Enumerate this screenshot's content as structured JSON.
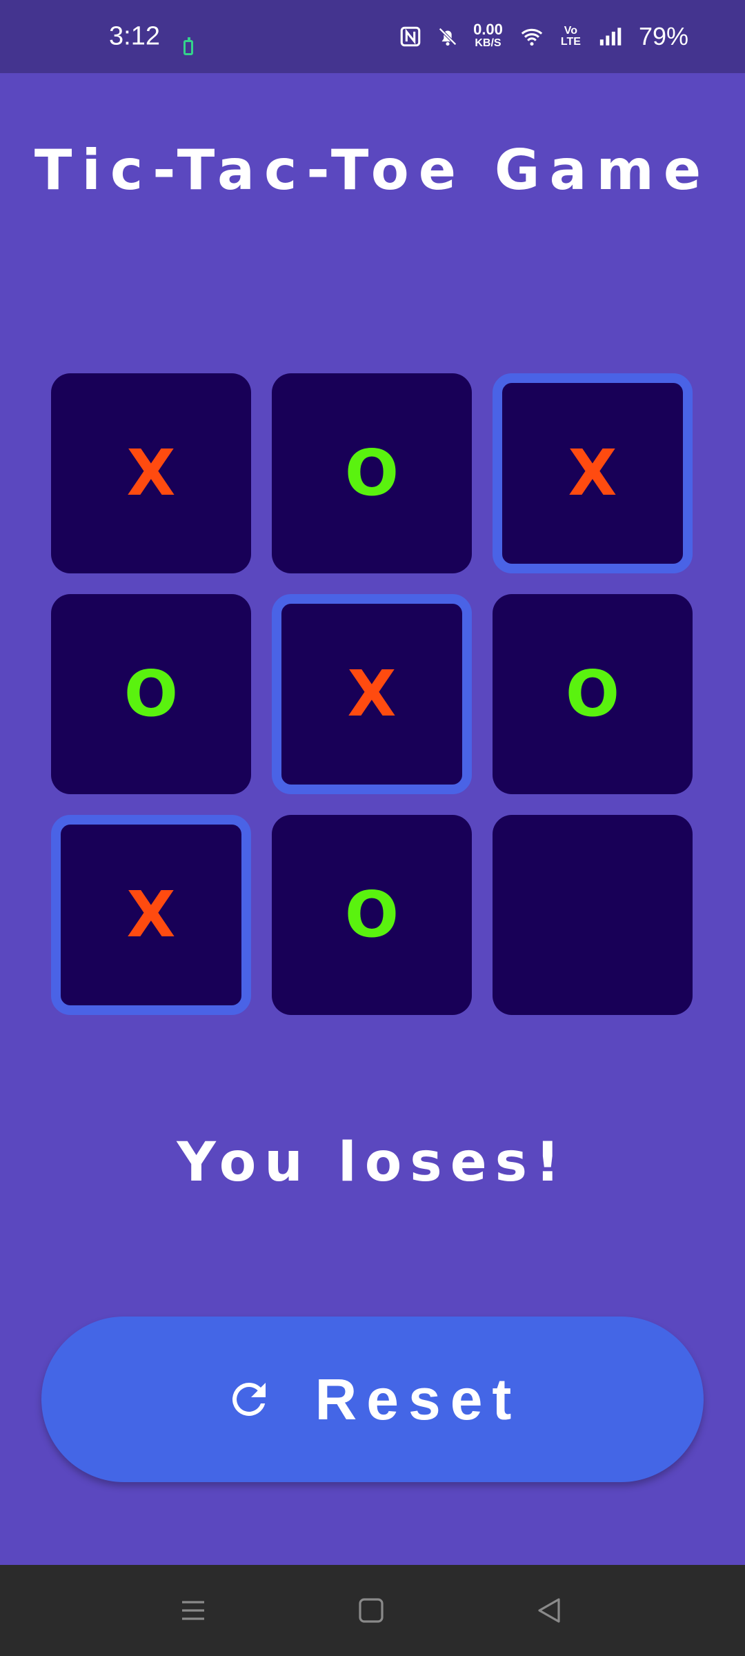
{
  "status_bar": {
    "time": "3:12",
    "network_speed_value": "0.00",
    "network_speed_unit": "KB/S",
    "volte_top": "Vo",
    "volte_bottom": "LTE",
    "battery_percent": "79%"
  },
  "title": "Tic-Tac-Toe Game",
  "board": {
    "cells": [
      "X",
      "O",
      "X",
      "O",
      "X",
      "O",
      "X",
      "O",
      ""
    ],
    "winning_cells": [
      2,
      4,
      6
    ],
    "colors": {
      "x": "#ff4b10",
      "o": "#5af20f",
      "cell": "#180057",
      "highlight": "#4a63e6"
    }
  },
  "result_text": "You loses!",
  "reset_button": {
    "label": "Reset",
    "icon": "refresh-icon"
  },
  "nav_bar": {
    "icons": [
      "menu-icon",
      "home-square-icon",
      "back-triangle-icon"
    ]
  }
}
